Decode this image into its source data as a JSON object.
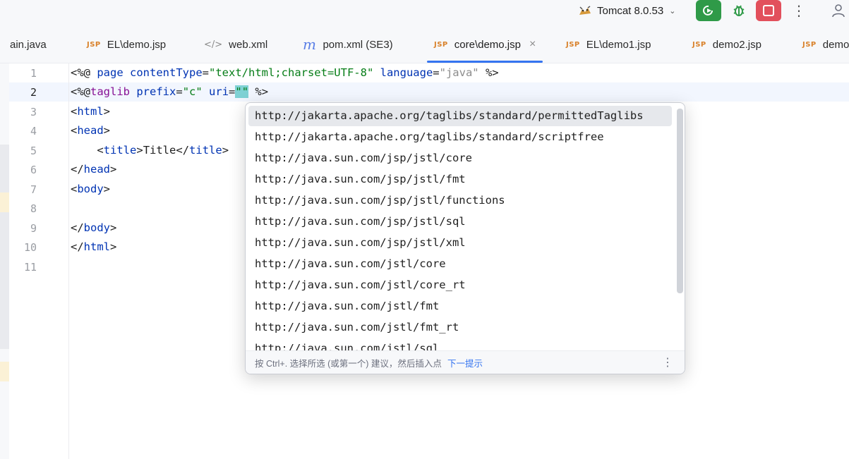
{
  "toolbar": {
    "run_config": "Tomcat 8.0.53",
    "run_config_icon": "tomcat-icon",
    "buttons": [
      "run-icon",
      "debug-icon",
      "stop-icon",
      "more-icon",
      "user-icon"
    ],
    "colors": {
      "run": "#2f9a48",
      "stop": "#e2505c"
    }
  },
  "tabs": [
    {
      "label": "ain.java",
      "icon": "",
      "active": false
    },
    {
      "label": "EL\\demo.jsp",
      "icon": "JSP",
      "active": false
    },
    {
      "label": "web.xml",
      "icon": "</>",
      "active": false
    },
    {
      "label": "pom.xml (SE3)",
      "icon": "m",
      "active": false
    },
    {
      "label": "core\\demo.jsp",
      "icon": "JSP",
      "active": true,
      "close": "×"
    },
    {
      "label": "EL\\demo1.jsp",
      "icon": "JSP",
      "active": false
    },
    {
      "label": "demo2.jsp",
      "icon": "JSP",
      "active": false
    },
    {
      "label": "demo",
      "icon": "JSP",
      "active": false
    }
  ],
  "editor": {
    "line_numbers": [
      "1",
      "2",
      "3",
      "4",
      "5",
      "6",
      "7",
      "8",
      "9",
      "10",
      "11"
    ],
    "current_line": 2,
    "lines": {
      "l1": {
        "open": "<%@ ",
        "page": "page",
        "sp1": " ",
        "attr1": "contentType",
        "eq1": "=",
        "val1": "\"text/html;charset=UTF-8\"",
        "sp2": " ",
        "attr2": "language",
        "eq2": "=",
        "val2": "\"java\"",
        "close": " %>"
      },
      "l2": {
        "open": "<%@",
        "taglib": "taglib",
        "sp1": " ",
        "attr1": "prefix",
        "eq1": "=",
        "val1": "\"c\"",
        "sp2": " ",
        "attr2": "uri",
        "eq2": "=",
        "val2": "\"\"",
        "close": " %>"
      },
      "l3": {
        "lt": "<",
        "tag": "html",
        "gt": ">"
      },
      "l4": {
        "lt": "<",
        "tag": "head",
        "gt": ">"
      },
      "l5": {
        "indent": "    ",
        "lt": "<",
        "tag": "title",
        "gt": ">",
        "text": "Title",
        "lt2": "</",
        "tag2": "title",
        "gt2": ">"
      },
      "l6": {
        "lt": "</",
        "tag": "head",
        "gt": ">"
      },
      "l7": {
        "lt": "<",
        "tag": "body",
        "gt": ">"
      },
      "l9": {
        "lt": "</",
        "tag": "body",
        "gt": ">"
      },
      "l10": {
        "lt": "</",
        "tag": "html",
        "gt": ">"
      }
    }
  },
  "completion": {
    "items": [
      "http://jakarta.apache.org/taglibs/standard/permittedTaglibs",
      "http://jakarta.apache.org/taglibs/standard/scriptfree",
      "http://java.sun.com/jsp/jstl/core",
      "http://java.sun.com/jsp/jstl/fmt",
      "http://java.sun.com/jsp/jstl/functions",
      "http://java.sun.com/jsp/jstl/sql",
      "http://java.sun.com/jsp/jstl/xml",
      "http://java.sun.com/jstl/core",
      "http://java.sun.com/jstl/core_rt",
      "http://java.sun.com/jstl/fmt",
      "http://java.sun.com/jstl/fmt_rt",
      "http://java.sun.com/jstl/sql"
    ],
    "selected_index": 0,
    "footer_hint": "按 Ctrl+. 选择所选 (或第一个) 建议，然后插入点",
    "footer_link": "下一提示",
    "footer_more": "⋮"
  }
}
